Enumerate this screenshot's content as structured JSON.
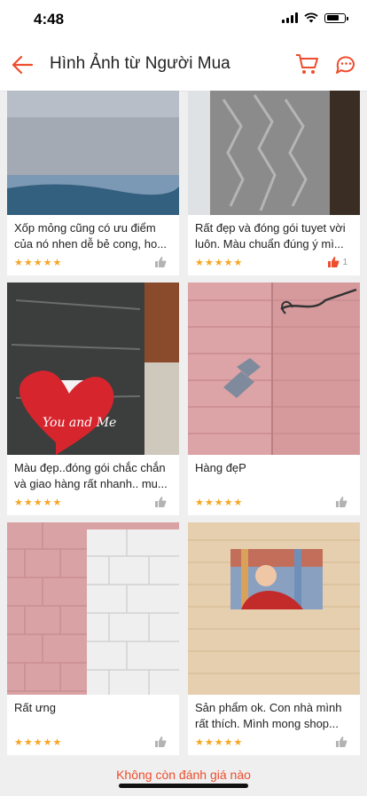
{
  "status": {
    "time": "4:48"
  },
  "header": {
    "title": "Hình Ảnh từ Người Mua"
  },
  "reviews": [
    {
      "caption": "Xốp mỏng cũng có ưu điểm của nó nhen dễ bẻ cong, ho...",
      "rating": 5,
      "likes": "",
      "liked": false
    },
    {
      "caption": "Rất đẹp và đóng gói tuyet vời luôn. Màu chuẩn đúng ý mì...",
      "rating": 5,
      "likes": "1",
      "liked": true
    },
    {
      "caption": "Màu đẹp..đóng gói chắc chắn và giao hàng rất nhanh.. mu...",
      "rating": 5,
      "likes": "",
      "liked": false
    },
    {
      "caption": "Hàng đẹP",
      "rating": 5,
      "likes": "",
      "liked": false
    },
    {
      "caption": "Rất ưng",
      "rating": 5,
      "likes": "",
      "liked": false
    },
    {
      "caption": "Sản phẩm ok. Con nhà mình rất thích. Mình mong shop...",
      "rating": 5,
      "likes": "",
      "liked": false
    }
  ],
  "photo_text": {
    "sticker": "You and Me"
  },
  "footer": {
    "no_more": "Không còn đánh giá nào"
  },
  "colors": {
    "accent": "#ee4d2d",
    "star": "#f6a623"
  },
  "icons": [
    "back-arrow-icon",
    "cart-icon",
    "chat-icon",
    "star-icon",
    "thumbs-up-icon"
  ]
}
